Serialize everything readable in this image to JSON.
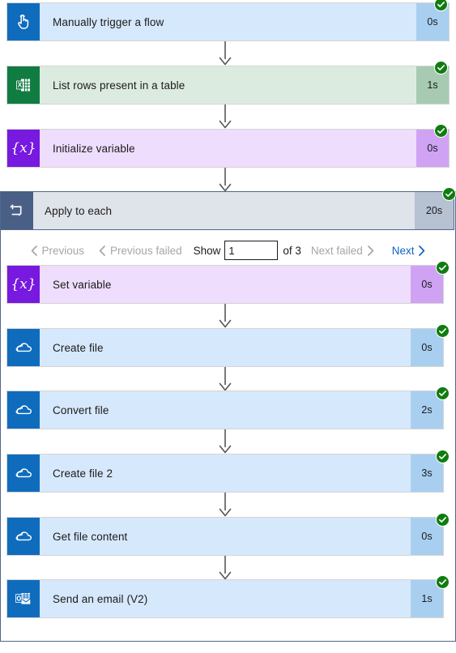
{
  "flow_run": {
    "steps": [
      {
        "id": "manually-trigger-a-flow",
        "title": "Manually trigger a flow",
        "duration": "0s",
        "status": "succeeded",
        "icon": "tap-hand-icon",
        "icon_bg": "#0f6cbd",
        "body_bg": "#d6e8fb",
        "duration_bg": "#a9cff0"
      },
      {
        "id": "list-rows-present-in-a-table",
        "title": "List rows present in a table",
        "duration": "1s",
        "status": "succeeded",
        "icon": "excel-table-icon",
        "icon_bg": "#107c41",
        "body_bg": "#dcebe0",
        "duration_bg": "#a6cbb2"
      },
      {
        "id": "initialize-variable",
        "title": "Initialize variable",
        "duration": "0s",
        "status": "succeeded",
        "icon": "variable-braces-icon",
        "icon_bg": "#7719df",
        "body_bg": "#eeddfc",
        "duration_bg": "#cfa2f3"
      }
    ],
    "scope": {
      "id": "apply-to-each",
      "title": "Apply to each",
      "duration": "20s",
      "status": "succeeded",
      "icon": "loop-repeat-icon",
      "icon_bg": "#4a5f85",
      "body_bg": "#dfe3ea",
      "duration_bg": "#b6c1d2",
      "pagination": {
        "previous_label": "Previous",
        "previous_failed_label": "Previous failed",
        "show_label": "Show",
        "page_value": "1",
        "of_label": "of 3",
        "next_failed_label": "Next failed",
        "next_label": "Next"
      },
      "steps": [
        {
          "id": "set-variable",
          "title": "Set variable",
          "duration": "0s",
          "status": "succeeded",
          "icon": "variable-braces-icon",
          "icon_bg": "#7719df",
          "body_bg": "#eeddfc",
          "duration_bg": "#cfa2f3"
        },
        {
          "id": "create-file",
          "title": "Create file",
          "duration": "0s",
          "status": "succeeded",
          "icon": "onedrive-cloud-icon",
          "icon_bg": "#0f6cbd",
          "body_bg": "#d6e8fb",
          "duration_bg": "#a9cff0"
        },
        {
          "id": "convert-file",
          "title": "Convert file",
          "duration": "2s",
          "status": "succeeded",
          "icon": "onedrive-cloud-icon",
          "icon_bg": "#0f6cbd",
          "body_bg": "#d6e8fb",
          "duration_bg": "#a9cff0"
        },
        {
          "id": "create-file-2",
          "title": "Create file 2",
          "duration": "3s",
          "status": "succeeded",
          "icon": "onedrive-cloud-icon",
          "icon_bg": "#0f6cbd",
          "body_bg": "#d6e8fb",
          "duration_bg": "#a9cff0"
        },
        {
          "id": "get-file-content",
          "title": "Get file content",
          "duration": "0s",
          "status": "succeeded",
          "icon": "onedrive-cloud-icon",
          "icon_bg": "#0f6cbd",
          "body_bg": "#d6e8fb",
          "duration_bg": "#a9cff0"
        },
        {
          "id": "send-an-email-v2",
          "title": "Send an email (V2)",
          "duration": "1s",
          "status": "succeeded",
          "icon": "outlook-envelope-icon",
          "icon_bg": "#0f6cbd",
          "body_bg": "#d6e8fb",
          "duration_bg": "#a9cff0"
        }
      ]
    },
    "colors": {
      "success_badge": "#107c10",
      "link_blue": "#0f62c8",
      "disabled_gray": "#a6a6a6",
      "scope_border": "#51678a",
      "connector_arrow": "#565656"
    }
  }
}
